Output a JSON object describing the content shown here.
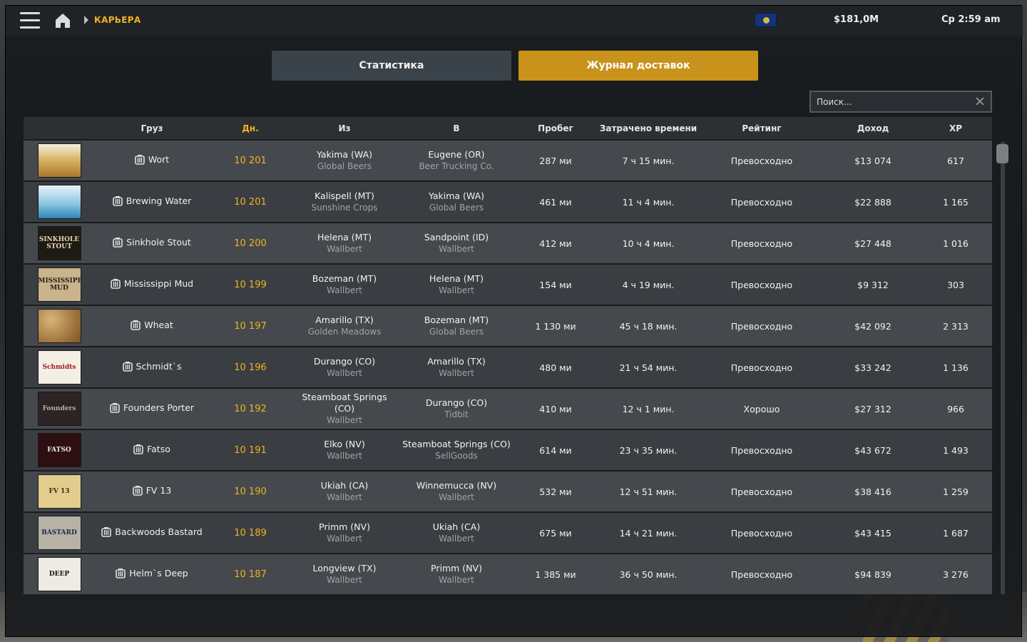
{
  "topbar": {
    "breadcrumb": "КАРЬЕРА",
    "money": "$181,0M",
    "clock": "Ср 2:59 am"
  },
  "tabs": {
    "stats": "Статистика",
    "log": "Журнал доставок"
  },
  "search": {
    "placeholder": "Поиск..."
  },
  "columns": {
    "cargo": "Груз",
    "day": "Дн.",
    "from": "Из",
    "to": "В",
    "distance": "Пробег",
    "time": "Затрачено времени",
    "rating": "Рейтинг",
    "income": "Доход",
    "xp": "XP"
  },
  "colors": {
    "accent": "#f2b21f",
    "active_tab": "#c8921b"
  },
  "rows": [
    {
      "cargo": "Wort",
      "day": "10 201",
      "from_city": "Yakima (WA)",
      "from_company": "Global Beers",
      "to_city": "Eugene (OR)",
      "to_company": "Beer Trucking Co.",
      "distance": "287 ми",
      "time": "7 ч 15 мин.",
      "rating": "Превосходно",
      "income": "$13 074",
      "xp": "617"
    },
    {
      "cargo": "Brewing Water",
      "day": "10 201",
      "from_city": "Kalispell (MT)",
      "from_company": "Sunshine Crops",
      "to_city": "Yakima (WA)",
      "to_company": "Global Beers",
      "distance": "461 ми",
      "time": "11 ч 4 мин.",
      "rating": "Превосходно",
      "income": "$22 888",
      "xp": "1 165"
    },
    {
      "cargo": "Sinkhole Stout",
      "day": "10 200",
      "from_city": "Helena (MT)",
      "from_company": "Wallbert",
      "to_city": "Sandpoint (ID)",
      "to_company": "Wallbert",
      "distance": "412 ми",
      "time": "10 ч 4 мин.",
      "rating": "Превосходно",
      "income": "$27 448",
      "xp": "1 016"
    },
    {
      "cargo": "Mississippi Mud",
      "day": "10 199",
      "from_city": "Bozeman (MT)",
      "from_company": "Wallbert",
      "to_city": "Helena (MT)",
      "to_company": "Wallbert",
      "distance": "154 ми",
      "time": "4 ч 19 мин.",
      "rating": "Превосходно",
      "income": "$9 312",
      "xp": "303"
    },
    {
      "cargo": "Wheat",
      "day": "10 197",
      "from_city": "Amarillo (TX)",
      "from_company": "Golden Meadows",
      "to_city": "Bozeman (MT)",
      "to_company": "Global Beers",
      "distance": "1 130 ми",
      "time": "45 ч 18 мин.",
      "rating": "Превосходно",
      "income": "$42 092",
      "xp": "2 313"
    },
    {
      "cargo": "Schmidt`s",
      "day": "10 196",
      "from_city": "Durango (CO)",
      "from_company": "Wallbert",
      "to_city": "Amarillo (TX)",
      "to_company": "Wallbert",
      "distance": "480 ми",
      "time": "21 ч 54 мин.",
      "rating": "Превосходно",
      "income": "$33 242",
      "xp": "1 136"
    },
    {
      "cargo": "Founders Porter",
      "day": "10 192",
      "from_city": "Steamboat Springs (CO)",
      "from_company": "Wallbert",
      "to_city": "Durango (CO)",
      "to_company": "Tidbit",
      "distance": "410 ми",
      "time": "12 ч 1 мин.",
      "rating": "Хорошо",
      "income": "$27 312",
      "xp": "966"
    },
    {
      "cargo": "Fatso",
      "day": "10 191",
      "from_city": "Elko (NV)",
      "from_company": "Wallbert",
      "to_city": "Steamboat Springs (CO)",
      "to_company": "SellGoods",
      "distance": "614 ми",
      "time": "23 ч 35 мин.",
      "rating": "Превосходно",
      "income": "$43 672",
      "xp": "1 493"
    },
    {
      "cargo": "FV 13",
      "day": "10 190",
      "from_city": "Ukiah (CA)",
      "from_company": "Wallbert",
      "to_city": "Winnemucca (NV)",
      "to_company": "Wallbert",
      "distance": "532 ми",
      "time": "12 ч 51 мин.",
      "rating": "Превосходно",
      "income": "$38 416",
      "xp": "1 259"
    },
    {
      "cargo": "Backwoods Bastard",
      "day": "10 189",
      "from_city": "Primm (NV)",
      "from_company": "Wallbert",
      "to_city": "Ukiah (CA)",
      "to_company": "Wallbert",
      "distance": "675 ми",
      "time": "14 ч 21 мин.",
      "rating": "Превосходно",
      "income": "$43 415",
      "xp": "1 687"
    },
    {
      "cargo": "Helm`s Deep",
      "day": "10 187",
      "from_city": "Longview (TX)",
      "from_company": "Wallbert",
      "to_city": "Primm (NV)",
      "to_company": "Wallbert",
      "distance": "1 385 ми",
      "time": "36 ч 50 мин.",
      "rating": "Превосходно",
      "income": "$94 839",
      "xp": "3 276"
    }
  ]
}
